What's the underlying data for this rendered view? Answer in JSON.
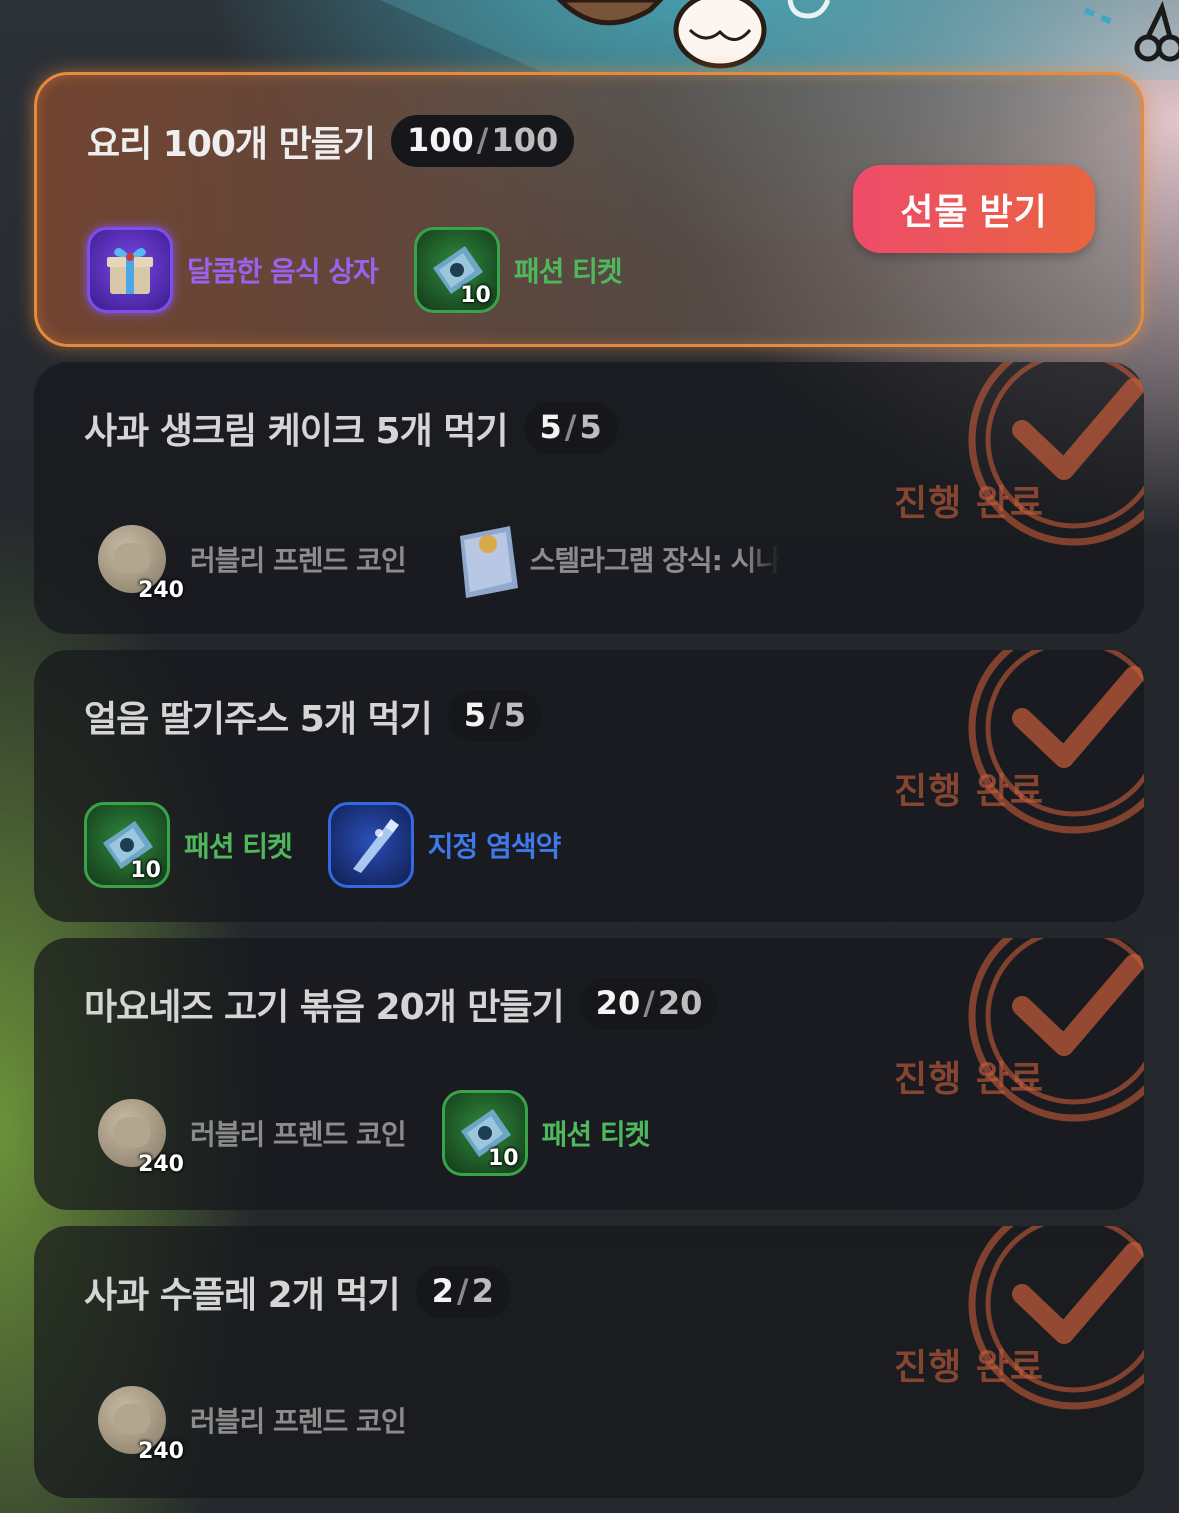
{
  "claim_button": "선물 받기",
  "stamp_text": "진행 완료",
  "missions": [
    {
      "title": "요리 100개 만들기",
      "progress_current": "100",
      "progress_separator": "/",
      "progress_total": "100",
      "rewards": [
        {
          "label": "달콤한 음식 상자",
          "icon": "gift-box-icon",
          "color": "#9b62ef"
        },
        {
          "label": "패션 티켓",
          "icon": "fashion-ticket-icon",
          "quantity": "10",
          "color": "#4fb85c"
        }
      ]
    },
    {
      "title": "사과 생크림 케이크 5개 먹기",
      "progress_current": "5",
      "progress_separator": "/",
      "progress_total": "5",
      "rewards": [
        {
          "label": "러블리 프렌드 코인",
          "icon": "friend-coin-icon",
          "quantity": "240",
          "color": "#8c8c8c"
        },
        {
          "label": "스텔라그램 장식: 시나",
          "icon": "stellagram-decoration-icon",
          "color": "#8c8c8c"
        }
      ]
    },
    {
      "title": "얼음 딸기주스 5개 먹기",
      "progress_current": "5",
      "progress_separator": "/",
      "progress_total": "5",
      "rewards": [
        {
          "label": "패션 티켓",
          "icon": "fashion-ticket-icon",
          "quantity": "10",
          "color": "#4fb85c"
        },
        {
          "label": "지정 염색약",
          "icon": "dye-icon",
          "color": "#3f78e8"
        }
      ]
    },
    {
      "title": "마요네즈 고기 볶음 20개 만들기",
      "progress_current": "20",
      "progress_separator": "/",
      "progress_total": "20",
      "rewards": [
        {
          "label": "러블리 프렌드 코인",
          "icon": "friend-coin-icon",
          "quantity": "240",
          "color": "#8c8c8c"
        },
        {
          "label": "패션 티켓",
          "icon": "fashion-ticket-icon",
          "quantity": "10",
          "color": "#4fb85c"
        }
      ]
    },
    {
      "title": "사과 수플레 2개 먹기",
      "progress_current": "2",
      "progress_separator": "/",
      "progress_total": "2",
      "rewards": [
        {
          "label": "러블리 프렌드 코인",
          "icon": "friend-coin-icon",
          "quantity": "240",
          "color": "#8c8c8c"
        }
      ]
    }
  ]
}
